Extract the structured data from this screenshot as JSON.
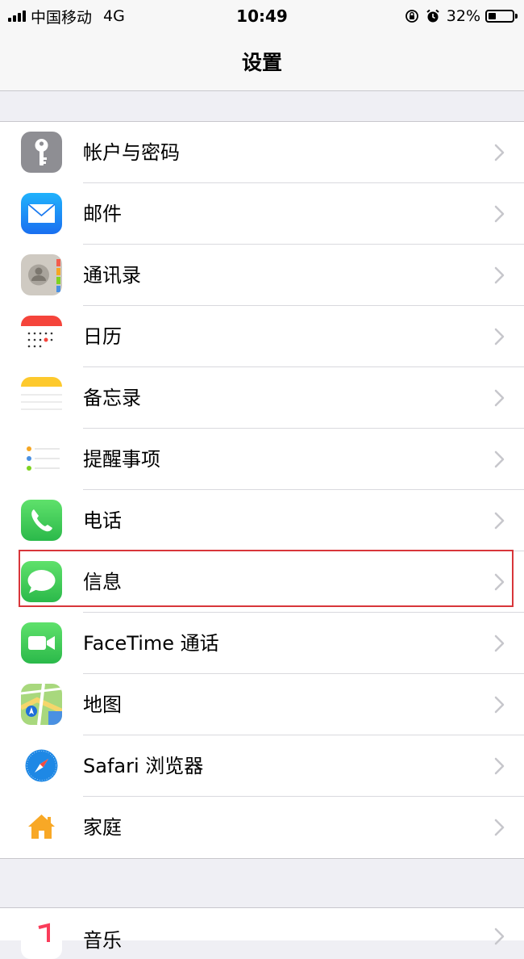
{
  "status_bar": {
    "carrier": "中国移动",
    "network": "4G",
    "time": "10:49",
    "battery_percent": "32%",
    "battery_level": 0.32,
    "icons": [
      "signal-icon",
      "orientation-lock-icon",
      "alarm-icon",
      "battery-icon"
    ]
  },
  "nav": {
    "title": "设置"
  },
  "settings": {
    "items": [
      {
        "label": "帐户与密码",
        "icon": "key-icon",
        "color": "#8e8e93"
      },
      {
        "label": "邮件",
        "icon": "mail-icon",
        "color": "#1a8cf5"
      },
      {
        "label": "通讯录",
        "icon": "contacts-icon",
        "color": "#b9b5ae"
      },
      {
        "label": "日历",
        "icon": "calendar-icon",
        "color": "#ffffff"
      },
      {
        "label": "备忘录",
        "icon": "notes-icon",
        "color": "#fecb2e"
      },
      {
        "label": "提醒事项",
        "icon": "reminders-icon",
        "color": "#ffffff"
      },
      {
        "label": "电话",
        "icon": "phone-icon",
        "color": "#34c759"
      },
      {
        "label": "信息",
        "icon": "messages-icon",
        "color": "#34c759"
      },
      {
        "label": "FaceTime 通话",
        "icon": "facetime-icon",
        "color": "#34c759"
      },
      {
        "label": "地图",
        "icon": "maps-icon",
        "color": "#6dbf5b"
      },
      {
        "label": "Safari 浏览器",
        "icon": "safari-icon",
        "color": "#1e88e5"
      },
      {
        "label": "家庭",
        "icon": "home-icon",
        "color": "#ffffff"
      }
    ],
    "highlighted": "信息",
    "highlight_color": "#d8363a",
    "next_section_partial": {
      "label": "音乐",
      "icon": "music-icon"
    }
  }
}
